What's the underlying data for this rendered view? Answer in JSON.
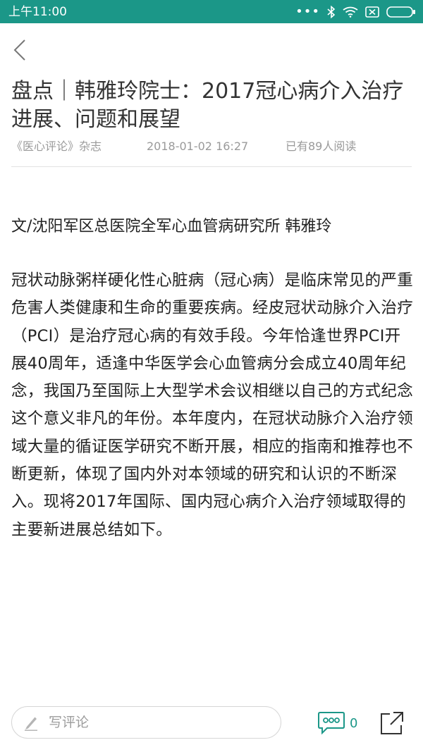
{
  "status_bar": {
    "time": "上午11:00",
    "dots": "•••",
    "icons": [
      "bluetooth-icon",
      "wifi-icon",
      "sim-disabled-icon",
      "battery-icon"
    ]
  },
  "article": {
    "title": "盘点｜韩雅玲院士：2017冠心病介入治疗进展、问题和展望",
    "source": "《医心评论》杂志",
    "date": "2018-01-02 16:27",
    "reads": "已有89人阅读",
    "author_line": "文/沈阳军区总医院全军心血管病研究所 韩雅玲",
    "paragraph": "冠状动脉粥样硬化性心脏病（冠心病）是临床常见的严重危害人类健康和生命的重要疾病。经皮冠状动脉介入治疗（PCI）是治疗冠心病的有效手段。今年恰逢世界PCI开展40周年，适逢中华医学会心血管病分会成立40周年纪念，我国乃至国际上大型学术会议相继以自己的方式纪念这个意义非凡的年份。本年度内，在冠状动脉介入治疗领域大量的循证医学研究不断开展，相应的指南和推荐也不断更新，体现了国内外对本领域的研究和认识的不断深入。现将2017年国际、国内冠心病介入治疗领域取得的主要新进展总结如下。"
  },
  "bottom_bar": {
    "comment_placeholder": "写评论",
    "comment_count": "0"
  },
  "colors": {
    "accent": "#1b9788",
    "text": "#222222",
    "meta": "#9a9a9a"
  }
}
